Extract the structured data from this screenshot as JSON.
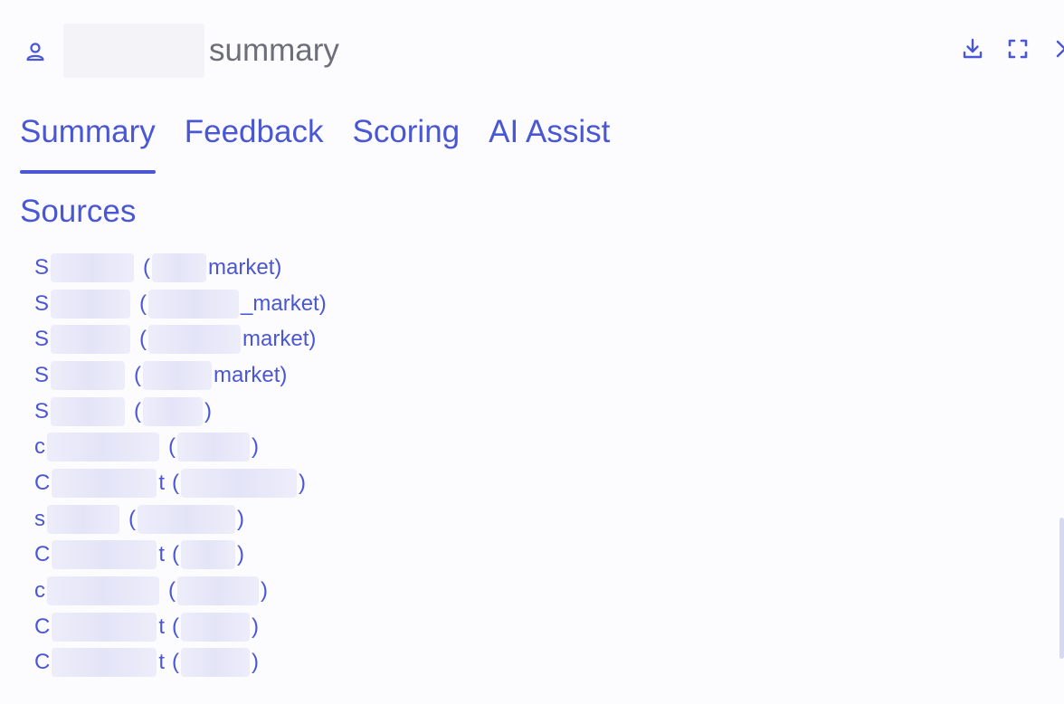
{
  "header": {
    "title": "summary",
    "icons": [
      "user-icon",
      "download-icon",
      "fullscreen-icon",
      "close-icon"
    ]
  },
  "tabs": [
    {
      "label": "Summary",
      "active": true
    },
    {
      "label": "Feedback",
      "active": false
    },
    {
      "label": "Scoring",
      "active": false
    },
    {
      "label": "AI Assist",
      "active": false
    }
  ],
  "sources": {
    "heading": "Sources",
    "items": [
      {
        "prefix": "S",
        "mid": "",
        "paren_open": "(",
        "paren_text": "market)"
      },
      {
        "prefix": "S",
        "mid": "",
        "paren_open": "(",
        "paren_text": "_market)"
      },
      {
        "prefix": "S",
        "mid": "",
        "paren_open": "(",
        "paren_text": "market)"
      },
      {
        "prefix": "S",
        "mid": "",
        "paren_open": "(",
        "paren_text": "market)"
      },
      {
        "prefix": "S",
        "mid": "",
        "paren_open": "(",
        "paren_text": ")"
      },
      {
        "prefix": "c",
        "mid": "",
        "paren_open": "(",
        "paren_text": ")"
      },
      {
        "prefix": "C",
        "mid": "t",
        "paren_open": "(",
        "paren_text": ")"
      },
      {
        "prefix": "s",
        "mid": "",
        "paren_open": "(",
        "paren_text": ")"
      },
      {
        "prefix": "C",
        "mid": "t",
        "paren_open": "(",
        "paren_text": ")"
      },
      {
        "prefix": "c",
        "mid": "",
        "paren_open": "(",
        "paren_text": ")"
      },
      {
        "prefix": "C",
        "mid": "t",
        "paren_open": "(",
        "paren_text": ")"
      },
      {
        "prefix": "C",
        "mid": "t",
        "paren_open": "(",
        "paren_text": ")"
      }
    ]
  },
  "colors": {
    "accent": "#4a57d4",
    "title_text": "#6e6e78",
    "background": "#fcfcfe"
  }
}
